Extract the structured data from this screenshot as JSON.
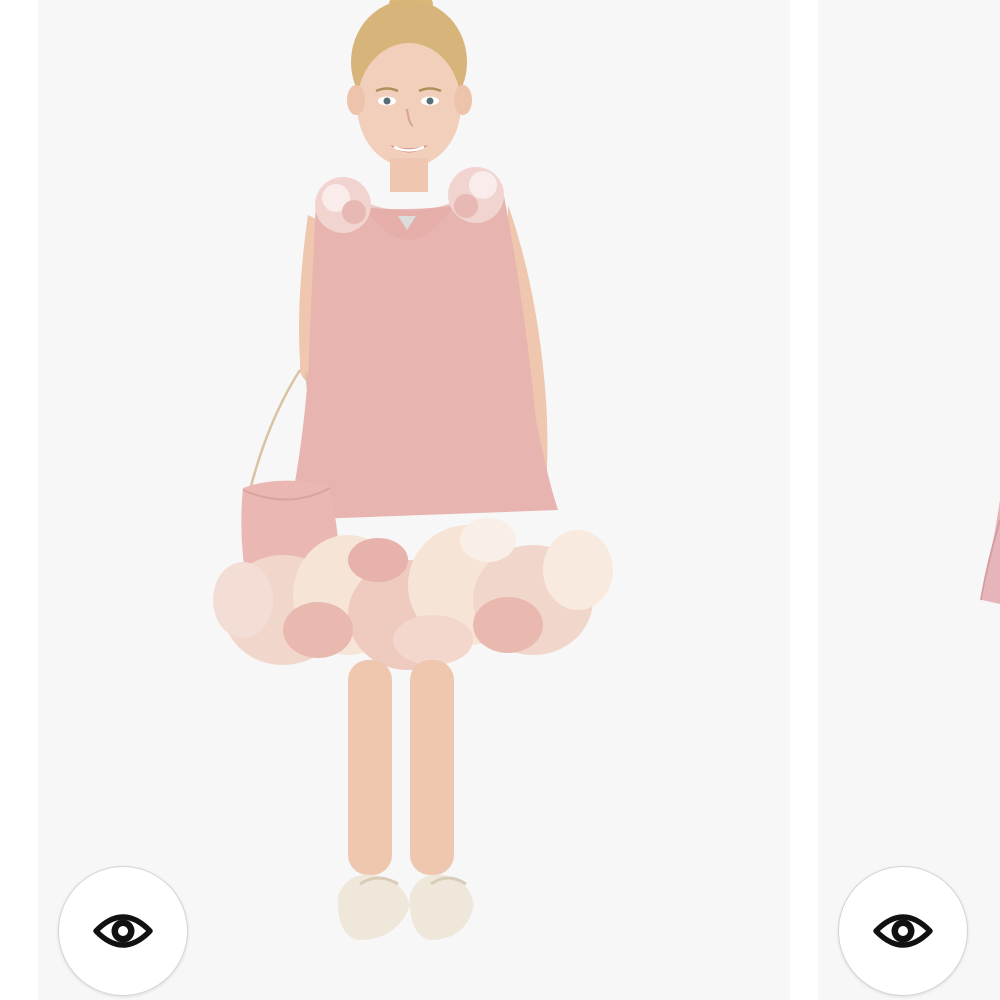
{
  "colors": {
    "card_background": "#f7f7f7",
    "page_background": "#ffffff",
    "dress_pink": "#e8b4b0",
    "ruffle_cream": "#f3dccd",
    "icon_black": "#111111"
  },
  "products": [
    {
      "image": "girl-in-pink-dress-with-flower-ruffle-hem-and-purse",
      "quick_view_icon": "eye-icon"
    },
    {
      "image": "pink-dress-partial",
      "quick_view_icon": "eye-icon"
    }
  ]
}
